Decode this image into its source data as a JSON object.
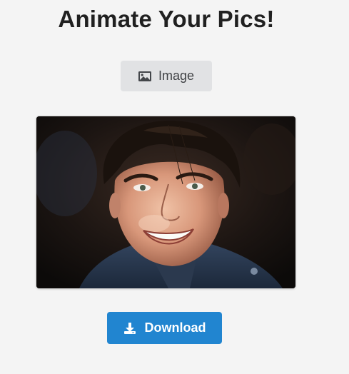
{
  "header": {
    "title": "Animate Your Pics!"
  },
  "upload_button": {
    "label": "Image",
    "icon": "image-icon"
  },
  "preview": {
    "icon": "portrait-photo"
  },
  "download_button": {
    "label": "Download",
    "icon": "download-icon"
  },
  "colors": {
    "background": "#f4f4f4",
    "title": "#202020",
    "upload_button_bg": "#e1e2e4",
    "download_button_bg": "#2185d0"
  }
}
